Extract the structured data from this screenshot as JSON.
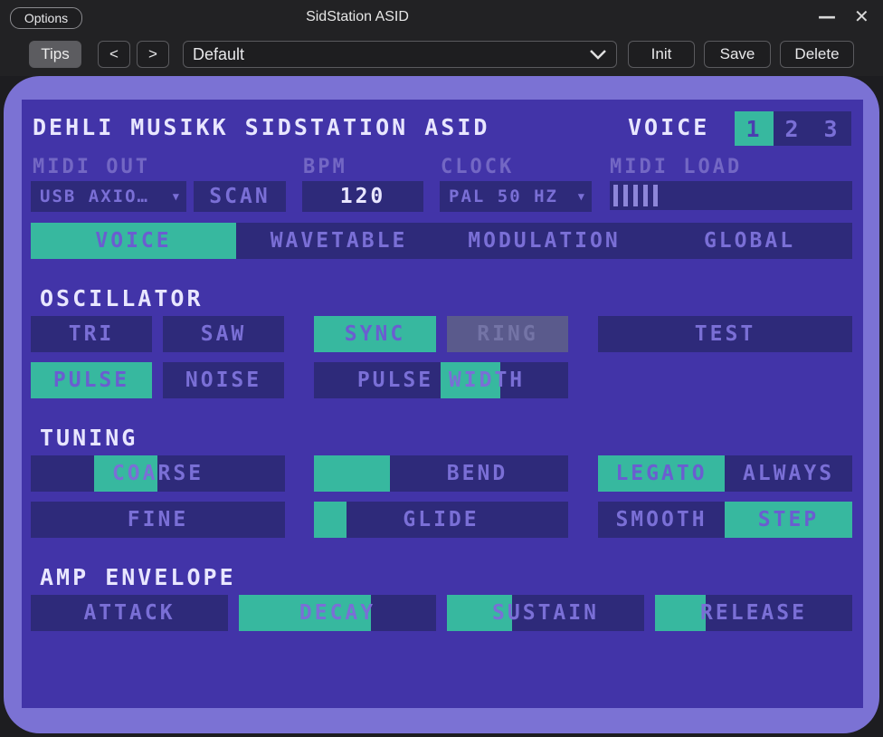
{
  "host": {
    "options_label": "Options",
    "window_title": "SidStation ASID",
    "minimize_glyph": "—",
    "close_glyph": "✕",
    "tips_label": "Tips",
    "prev_label": "<",
    "next_label": ">",
    "preset_value": "Default",
    "init_label": "Init",
    "save_label": "Save",
    "delete_label": "Delete"
  },
  "plugin": {
    "title": "DEHLI MUSIKK SIDSTATION ASID",
    "voice_label": "VOICE",
    "voices": [
      "1",
      "2",
      "3"
    ],
    "selected_voice": "1",
    "midi_out_label": "MIDI OUT",
    "midi_out_value": "USB AXIO…",
    "scan_label": "SCAN",
    "bpm_label": "BPM",
    "bpm_value": "120",
    "clock_label": "CLOCK",
    "clock_value": "PAL 50 HZ",
    "midi_load_label": "MIDI LOAD",
    "midi_load_bars": 5,
    "tabs": [
      "VOICE",
      "WAVETABLE",
      "MODULATION",
      "GLOBAL"
    ],
    "active_tab": "VOICE",
    "oscillator": {
      "heading": "OSCILLATOR",
      "tri": "TRI",
      "saw": "SAW",
      "sync": "SYNC",
      "ring": "RING",
      "test": "TEST",
      "pulse": "PULSE",
      "noise": "NOISE",
      "pulse_width": "PULSE WIDTH",
      "pulse_width_level": 0.5
    },
    "tuning": {
      "heading": "TUNING",
      "coarse": "COARSE",
      "coarse_position": 0.5,
      "bend": "BEND",
      "bend_level": 0.3,
      "legato": "LEGATO",
      "always": "ALWAYS",
      "fine": "FINE",
      "glide": "GLIDE",
      "glide_level": 0.13,
      "smooth": "SMOOTH",
      "step": "STEP"
    },
    "envelope": {
      "heading": "AMP ENVELOPE",
      "attack": "ATTACK",
      "attack_level": 0,
      "decay": "DECAY",
      "decay_level": 0.67,
      "sustain": "SUSTAIN",
      "sustain_level": 0.33,
      "release": "RELEASE",
      "release_level": 0.25
    }
  },
  "colors": {
    "frame": "#7b72d4",
    "screen": "#4234a8",
    "control": "#2e2a7a",
    "active": "#37b89f",
    "text_bright": "#e8e6ff",
    "text_dim": "#7a6fd6"
  }
}
